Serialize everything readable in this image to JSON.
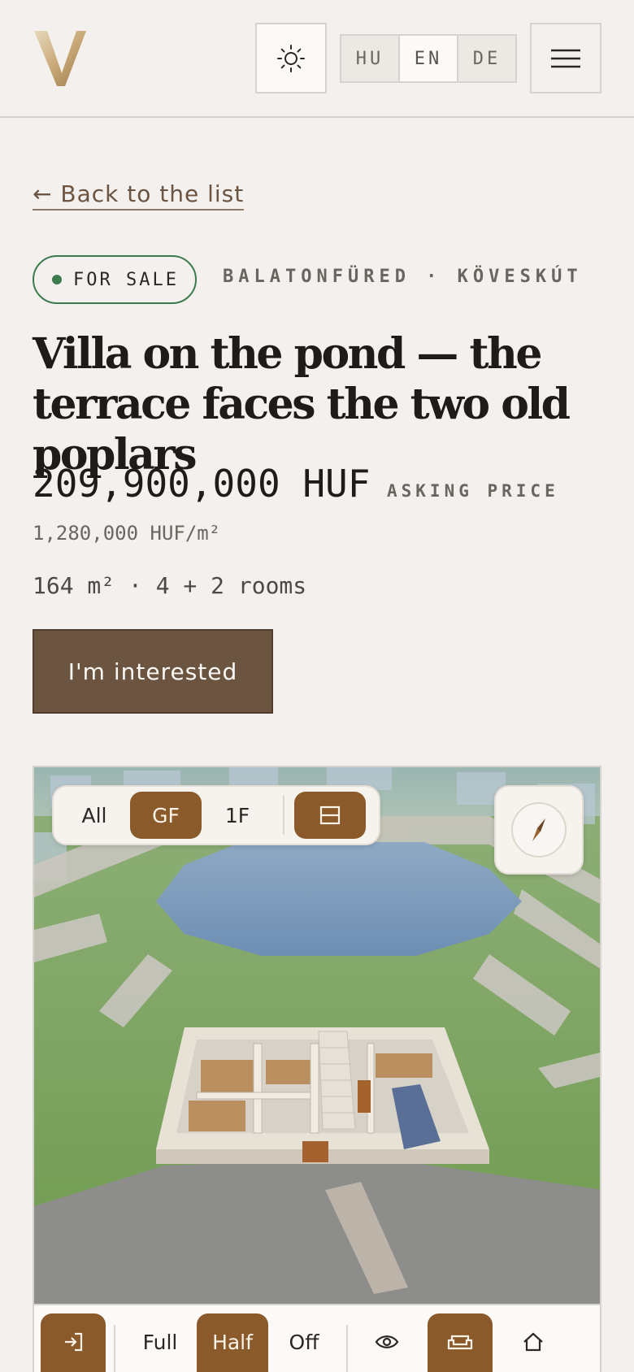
{
  "header": {
    "logo_letter": "V",
    "theme_icon": "sun-icon",
    "languages": [
      {
        "label": "HU",
        "active": false
      },
      {
        "label": "EN",
        "active": true
      },
      {
        "label": "DE",
        "active": false
      }
    ],
    "menu_icon": "hamburger-icon"
  },
  "back_link": "← Back to the list",
  "listing": {
    "status": "FOR SALE",
    "location": "BALATONFÜRED · KÖVESKÚT",
    "title": "Villa on the pond — the terrace faces the two old poplars",
    "price": "209,900,000 HUF",
    "price_label": "ASKING PRICE",
    "price_per_m2": "1,280,000 HUF/m²",
    "specs": "164 m² · 4 + 2 rooms",
    "cta_label": "I'm interested"
  },
  "viewer": {
    "floors": [
      {
        "label": "All",
        "active": false
      },
      {
        "label": "GF",
        "active": true
      },
      {
        "label": "1F",
        "active": false
      }
    ],
    "plan_toggle_icon": "floorplan-icon",
    "compass_icon": "compass-icon",
    "toolbar": {
      "enter_icon": "enter-icon",
      "wall_modes": [
        {
          "label": "Full",
          "active": false
        },
        {
          "label": "Half",
          "active": true
        },
        {
          "label": "Off",
          "active": false
        }
      ],
      "view_icon": "eye-icon",
      "furniture_icon": "sofa-icon",
      "home_icon": "home-icon"
    }
  },
  "colors": {
    "background": "#f3f0ee",
    "accent": "#8b5a2b",
    "cta": "#6b5541",
    "status_green": "#3d7a4f"
  }
}
